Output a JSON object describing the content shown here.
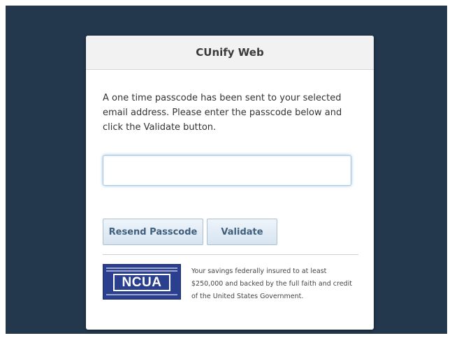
{
  "card": {
    "title": "CUnify Web"
  },
  "message": "A one time passcode has been sent to your selected email address. Please enter the passcode below and click the Validate button.",
  "passcode_input": {
    "value": "",
    "placeholder": ""
  },
  "buttons": {
    "resend_label": "Resend Passcode",
    "validate_label": "Validate"
  },
  "footer": {
    "logo_text": "NCUA",
    "insured_text": "Your savings federally insured to at least $250,000 and backed by the full faith and credit of the United States Government."
  }
}
